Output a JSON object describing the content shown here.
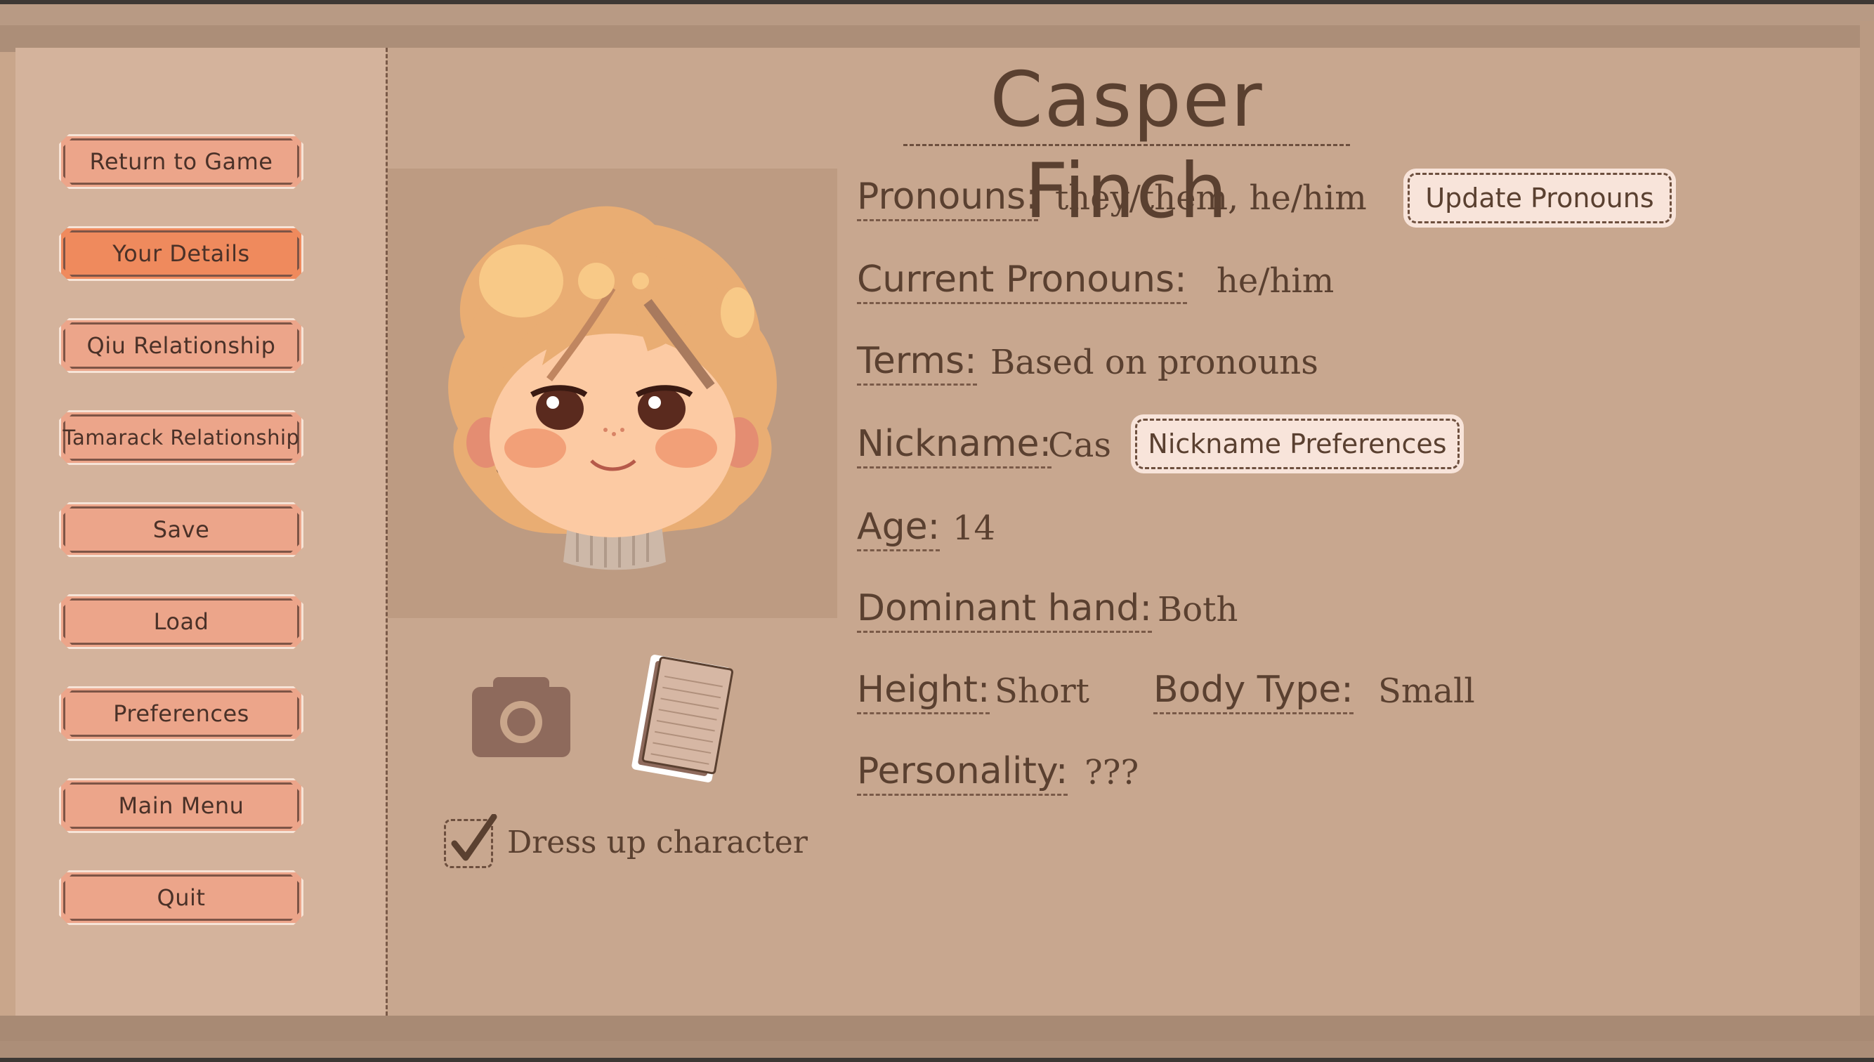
{
  "menu": {
    "items": [
      {
        "label": "Return to Game",
        "active": false
      },
      {
        "label": "Your Details",
        "active": true
      },
      {
        "label": "Qiu Relationship",
        "active": false
      },
      {
        "label": "Tamarack Relationship",
        "active": false
      },
      {
        "label": "Save",
        "active": false
      },
      {
        "label": "Load",
        "active": false
      },
      {
        "label": "Preferences",
        "active": false
      },
      {
        "label": "Main Menu",
        "active": false
      },
      {
        "label": "Quit",
        "active": false
      }
    ]
  },
  "character": {
    "name": "Casper Finch"
  },
  "details": {
    "pronouns_label": "Pronouns:",
    "pronouns_value": "they/them, he/him",
    "update_pronouns_button": "Update Pronouns",
    "current_pronouns_label": "Current Pronouns:",
    "current_pronouns_value": "he/him",
    "terms_label": "Terms:",
    "terms_value": "Based on pronouns",
    "nickname_label": "Nickname:",
    "nickname_value": "Cas",
    "nickname_preferences_button": "Nickname Preferences",
    "age_label": "Age:",
    "age_value": "14",
    "dominant_hand_label": "Dominant hand:",
    "dominant_hand_value": "Both",
    "height_label": "Height:",
    "height_value": "Short",
    "body_type_label": "Body Type:",
    "body_type_value": "Small",
    "personality_label": "Personality:",
    "personality_value": "???"
  },
  "dress_up": {
    "label": "Dress up character",
    "checked": true
  },
  "icons": [
    "camera-icon",
    "notepad-icon",
    "checkmark-icon"
  ],
  "colors": {
    "active_button": "#ef8a5d",
    "button": "#eca58a",
    "text": "#5a4030"
  }
}
